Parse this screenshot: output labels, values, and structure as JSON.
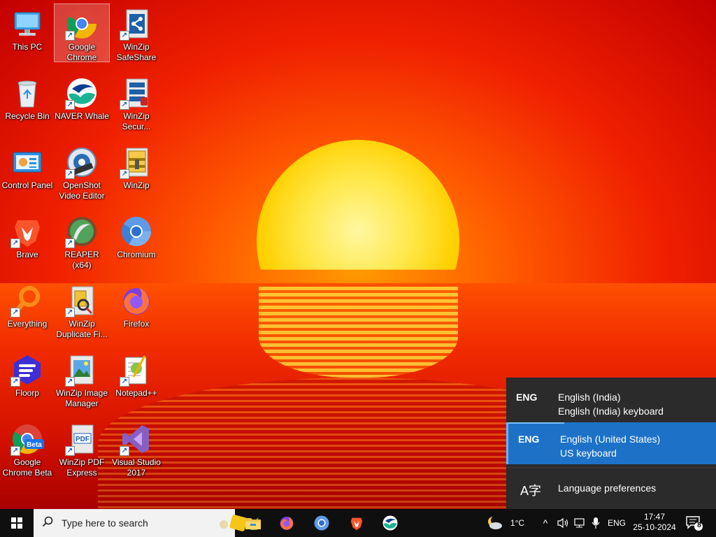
{
  "desktop_icons": [
    {
      "label": "This PC",
      "icon": "this-pc-icon"
    },
    {
      "label": "Google Chrome",
      "icon": "chrome-icon",
      "selected": true
    },
    {
      "label": "WinZip SafeShare",
      "icon": "winzip-safeshare-icon"
    },
    {
      "label": "Recycle Bin",
      "icon": "recycle-bin-icon"
    },
    {
      "label": "NAVER Whale",
      "icon": "naver-whale-icon"
    },
    {
      "label": "WinZip Secur...",
      "icon": "winzip-secure-icon"
    },
    {
      "label": "Control Panel",
      "icon": "control-panel-icon"
    },
    {
      "label": "OpenShot Video Editor",
      "icon": "openshot-icon"
    },
    {
      "label": "WinZip",
      "icon": "winzip-icon"
    },
    {
      "label": "Brave",
      "icon": "brave-icon"
    },
    {
      "label": "REAPER (x64)",
      "icon": "reaper-icon"
    },
    {
      "label": "Chromium",
      "icon": "chromium-icon"
    },
    {
      "label": "Everything",
      "icon": "everything-icon"
    },
    {
      "label": "WinZip Duplicate Fi...",
      "icon": "winzip-duplicate-icon"
    },
    {
      "label": "Firefox",
      "icon": "firefox-icon"
    },
    {
      "label": "Floorp",
      "icon": "floorp-icon"
    },
    {
      "label": "WinZip Image Manager",
      "icon": "winzip-image-icon"
    },
    {
      "label": "Notepad++",
      "icon": "notepadpp-icon"
    },
    {
      "label": "Google Chrome Beta",
      "icon": "chrome-beta-icon"
    },
    {
      "label": "WinZip PDF Express",
      "icon": "winzip-pdf-icon"
    },
    {
      "label": "Visual Studio 2017",
      "icon": "visual-studio-icon"
    }
  ],
  "language_popup": {
    "items": [
      {
        "code": "ENG",
        "language": "English (India)",
        "keyboard": "English (India) keyboard",
        "active": false
      },
      {
        "code": "ENG",
        "language": "English (United States)",
        "keyboard": "US keyboard",
        "active": true
      }
    ],
    "preferences_label": "Language preferences",
    "preferences_icon": "A字"
  },
  "taskbar": {
    "search_placeholder": "Type here to search",
    "pinned_apps": [
      "file-explorer-icon",
      "firefox-icon",
      "chromium-icon",
      "brave-icon",
      "naver-whale-icon"
    ],
    "weather_temp": "1°C",
    "language_indicator": "ENG",
    "time": "17:47",
    "date": "25-10-2024",
    "notification_count": "8"
  }
}
